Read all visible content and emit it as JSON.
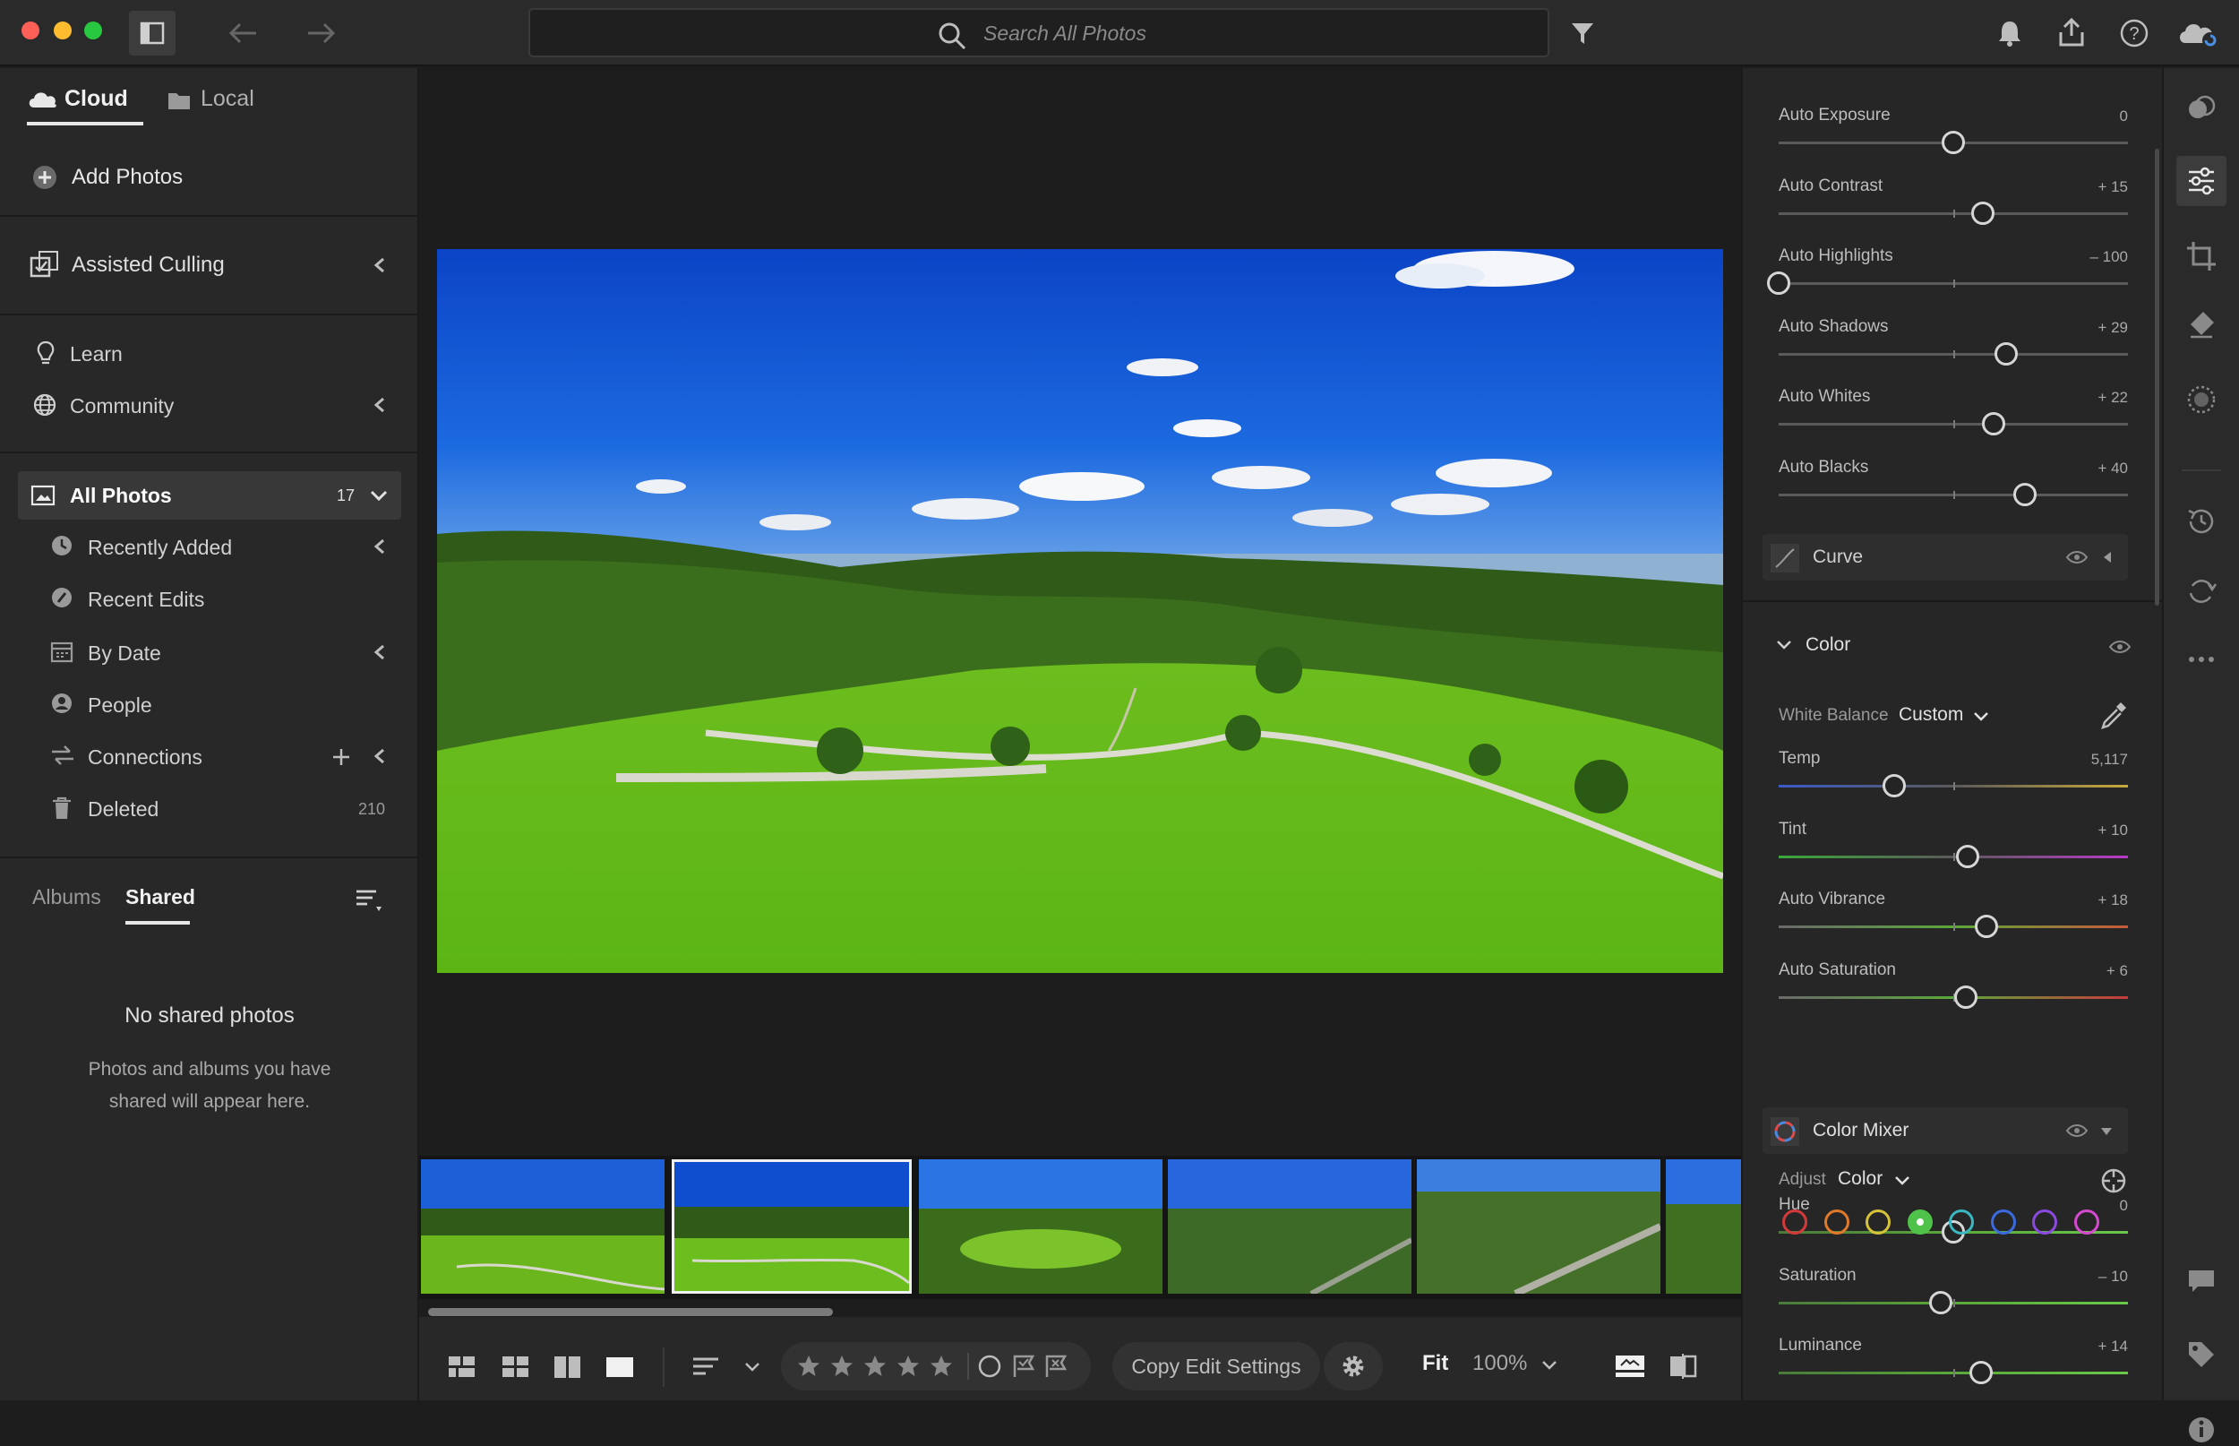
{
  "search": {
    "placeholder": "Search All Photos"
  },
  "left_panel": {
    "tabs": [
      {
        "label": "Cloud"
      },
      {
        "label": "Local"
      }
    ],
    "add_photos": "Add Photos",
    "assisted_culling": "Assisted Culling",
    "learn": "Learn",
    "community": "Community",
    "all_photos": {
      "label": "All Photos",
      "count": "17"
    },
    "items": [
      {
        "label": "Recently Added"
      },
      {
        "label": "Recent Edits"
      },
      {
        "label": "By Date"
      },
      {
        "label": "People"
      },
      {
        "label": "Connections"
      },
      {
        "label": "Deleted",
        "count": "210"
      }
    ],
    "albums_tab": "Albums",
    "shared_tab": "Shared",
    "empty_title": "No shared photos",
    "empty_line1": "Photos and albums you have",
    "empty_line2": "shared will appear here."
  },
  "light_sliders": [
    {
      "label": "Auto Exposure",
      "value": "0",
      "position": 0.5
    },
    {
      "label": "Auto Contrast",
      "value": "+ 15",
      "position": 0.585
    },
    {
      "label": "Auto Highlights",
      "value": "– 100",
      "position": 0.0
    },
    {
      "label": "Auto Shadows",
      "value": "+ 29",
      "position": 0.65
    },
    {
      "label": "Auto Whites",
      "value": "+ 22",
      "position": 0.615
    },
    {
      "label": "Auto Blacks",
      "value": "+ 40",
      "position": 0.705
    }
  ],
  "curve": {
    "label": "Curve"
  },
  "color": {
    "title": "Color",
    "white_balance_label": "White Balance",
    "white_balance_value": "Custom",
    "sliders": [
      {
        "label": "Temp",
        "value": "5,117",
        "position": 0.33
      },
      {
        "label": "Tint",
        "value": "+ 10",
        "position": 0.54
      },
      {
        "label": "Auto Vibrance",
        "value": "+ 18",
        "position": 0.595
      },
      {
        "label": "Auto Saturation",
        "value": "+ 6",
        "position": 0.535
      }
    ]
  },
  "color_mixer": {
    "title": "Color Mixer",
    "adjust_label": "Adjust",
    "adjust_value": "Color",
    "swatches": [
      "#d43a3a",
      "#e07a2a",
      "#d6c23a",
      "#4fc24a",
      "#3ab6c0",
      "#3a6ae0",
      "#8a4ae0",
      "#d64ad0"
    ],
    "selected_swatch": 3,
    "sliders": [
      {
        "label": "Hue",
        "value": "0",
        "position": 0.5
      },
      {
        "label": "Saturation",
        "value": "– 10",
        "position": 0.465
      },
      {
        "label": "Luminance",
        "value": "+ 14",
        "position": 0.58
      }
    ]
  },
  "toolbar": {
    "copy_edit": "Copy Edit Settings",
    "fit": "Fit",
    "zoom": "100%",
    "stars": 5
  },
  "colors": {
    "accent": "#4a90e2",
    "panel": "#282828",
    "text": "#d6d6d6"
  }
}
